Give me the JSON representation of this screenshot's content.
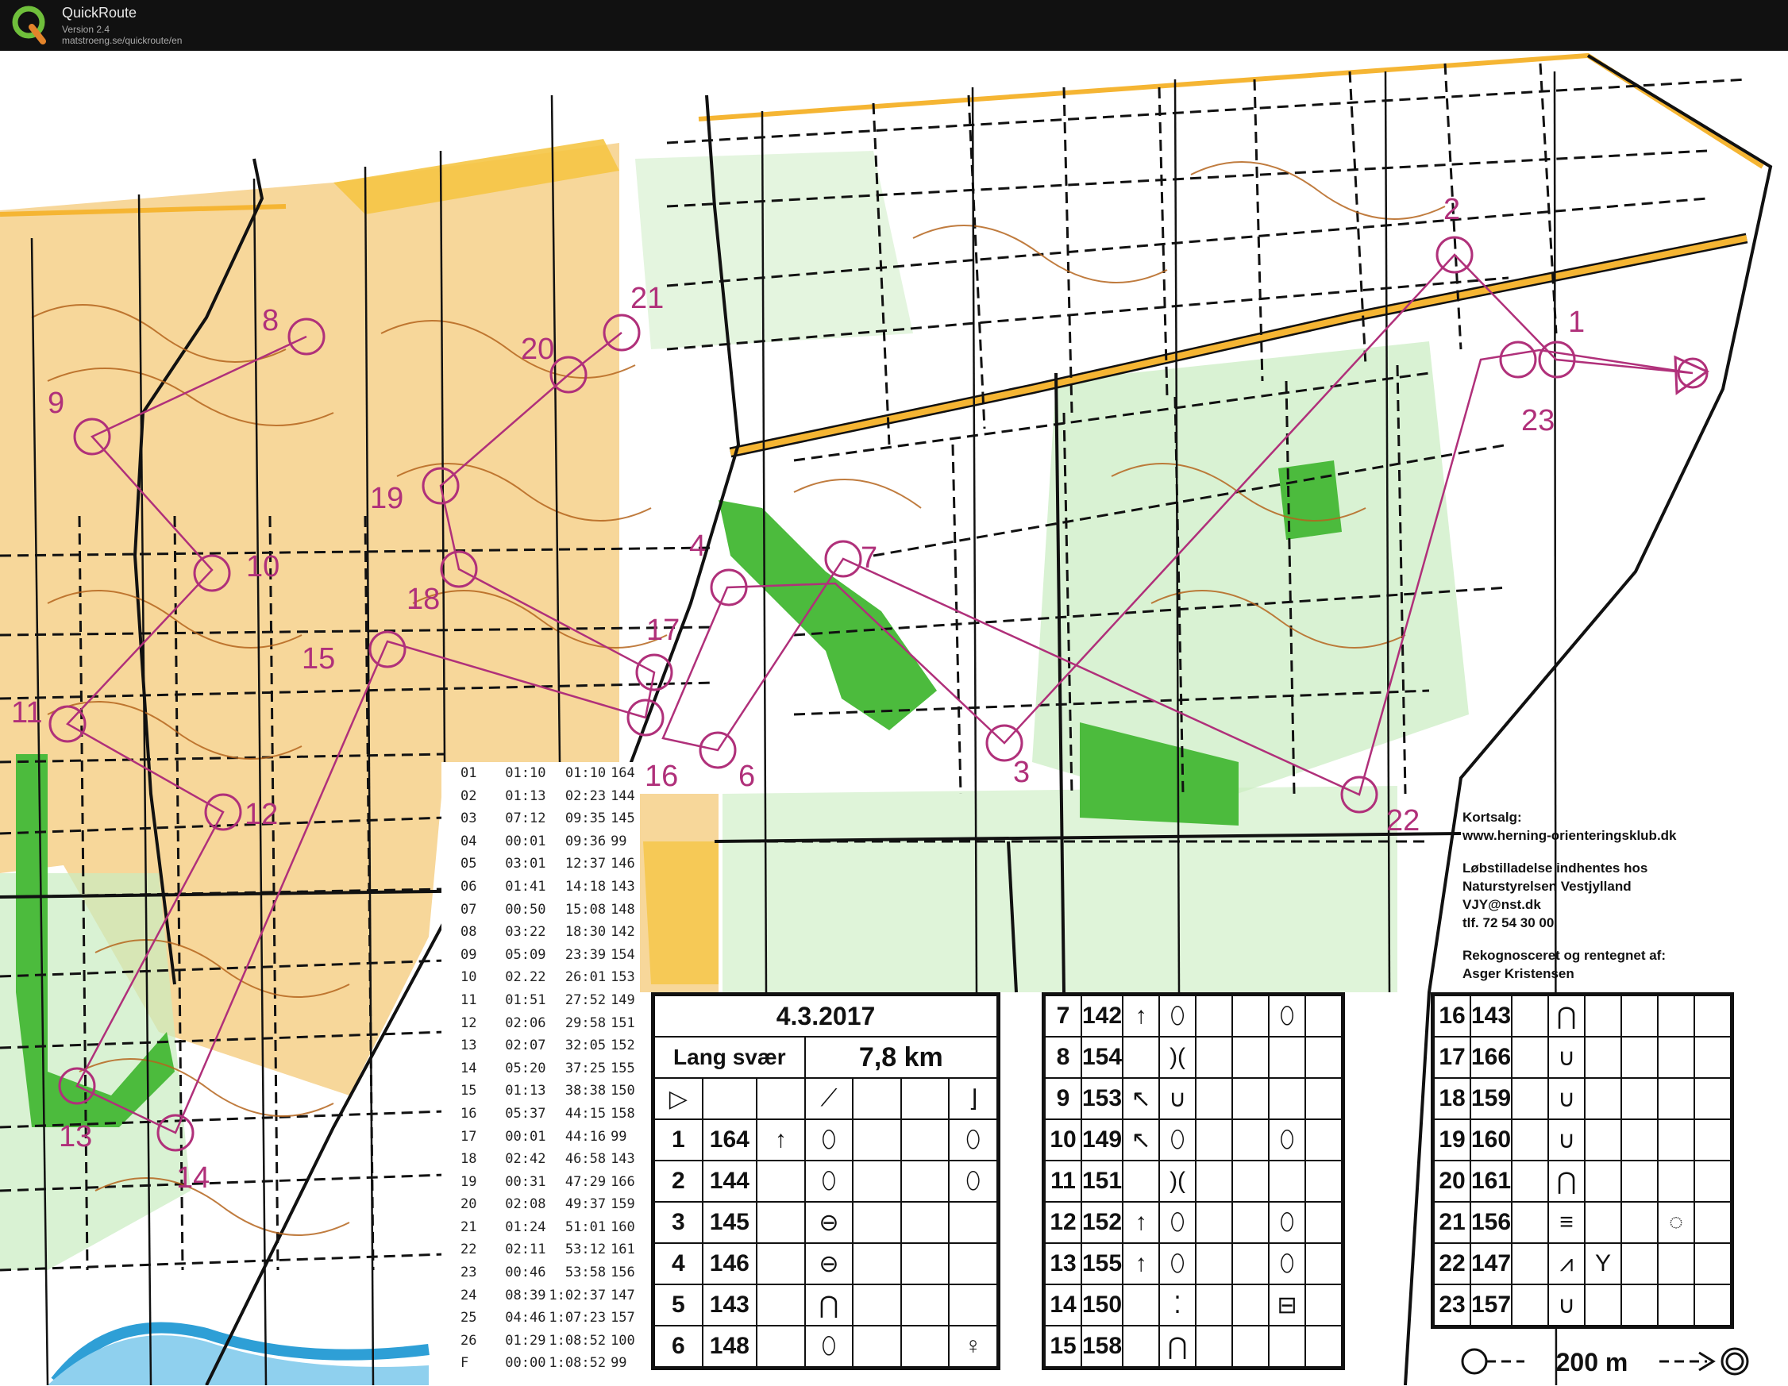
{
  "app": {
    "title": "QuickRoute",
    "version": "Version 2.4",
    "url": "matstroeng.se/quickroute/en",
    "logo_icon": "quickroute-q-logo"
  },
  "colors": {
    "open_land": "#f7d79a",
    "forest": "#ffffff",
    "green": "#4cbb3d",
    "light_green": "#c9ecc0",
    "contour": "#b5651d",
    "course": "#b0307a",
    "road": "#f5b533",
    "track": "#111111",
    "water": "#2e9fd6"
  },
  "controls": [
    {
      "label": "1"
    },
    {
      "label": "2"
    },
    {
      "label": "3"
    },
    {
      "label": "4"
    },
    {
      "label": "6"
    },
    {
      "label": "7"
    },
    {
      "label": "8"
    },
    {
      "label": "9"
    },
    {
      "label": "10"
    },
    {
      "label": "11"
    },
    {
      "label": "12"
    },
    {
      "label": "13"
    },
    {
      "label": "14"
    },
    {
      "label": "15"
    },
    {
      "label": "16"
    },
    {
      "label": "17"
    },
    {
      "label": "18"
    },
    {
      "label": "19"
    },
    {
      "label": "20"
    },
    {
      "label": "21"
    },
    {
      "label": "22"
    },
    {
      "label": "23"
    }
  ],
  "splits": [
    [
      "01",
      "01:10",
      "01:10",
      "164"
    ],
    [
      "02",
      "01:13",
      "02:23",
      "144"
    ],
    [
      "03",
      "07:12",
      "09:35",
      "145"
    ],
    [
      "04",
      "00:01",
      "09:36",
      "99"
    ],
    [
      "05",
      "03:01",
      "12:37",
      "146"
    ],
    [
      "06",
      "01:41",
      "14:18",
      "143"
    ],
    [
      "07",
      "00:50",
      "15:08",
      "148"
    ],
    [
      "08",
      "03:22",
      "18:30",
      "142"
    ],
    [
      "09",
      "05:09",
      "23:39",
      "154"
    ],
    [
      "10",
      "02.22",
      "26:01",
      "153"
    ],
    [
      "11",
      "01:51",
      "27:52",
      "149"
    ],
    [
      "12",
      "02:06",
      "29:58",
      "151"
    ],
    [
      "13",
      "02:07",
      "32:05",
      "152"
    ],
    [
      "14",
      "05:20",
      "37:25",
      "155"
    ],
    [
      "15",
      "01:13",
      "38:38",
      "150"
    ],
    [
      "16",
      "05:37",
      "44:15",
      "158"
    ],
    [
      "17",
      "00:01",
      "44:16",
      "99"
    ],
    [
      "18",
      "02:42",
      "46:58",
      "143"
    ],
    [
      "19",
      "00:31",
      "47:29",
      "166"
    ],
    [
      "20",
      "02:08",
      "49:37",
      "159"
    ],
    [
      "21",
      "01:24",
      "51:01",
      "160"
    ],
    [
      "22",
      "02:11",
      "53:12",
      "161"
    ],
    [
      "23",
      "00:46",
      "53:58",
      "156"
    ],
    [
      "24",
      "08:39",
      "1:02:37",
      "147"
    ],
    [
      "25",
      "04:46",
      "1:07:23",
      "157"
    ],
    [
      "26",
      "01:29",
      "1:08:52",
      "100"
    ],
    [
      "F",
      "00:00",
      "1:08:52",
      "99"
    ]
  ],
  "info": {
    "sale_heading": "Kortsalg:",
    "sale_url": "www.herning-orienteringsklub.dk",
    "permit_line1": "Løbstilladelse indhentes hos",
    "permit_line2": "Naturstyrelsen Vestjylland",
    "permit_email": "VJY@nst.dk",
    "permit_phone": "tlf. 72 54 30 00",
    "survey_heading": "Rekognosceret og rentegnet af:",
    "survey_name": "Asger Kristensen"
  },
  "description": {
    "date": "4.3.2017",
    "class": "Lang svær",
    "length": "7,8 km",
    "start_icon": "start-triangle-icon",
    "rows": [
      {
        "num": "1",
        "code": "164"
      },
      {
        "num": "2",
        "code": "144"
      },
      {
        "num": "3",
        "code": "145"
      },
      {
        "num": "4",
        "code": "146"
      },
      {
        "num": "5",
        "code": "143"
      },
      {
        "num": "6",
        "code": "148"
      },
      {
        "num": "7",
        "code": "142"
      },
      {
        "num": "8",
        "code": "154"
      },
      {
        "num": "9",
        "code": "153"
      },
      {
        "num": "10",
        "code": "149"
      },
      {
        "num": "11",
        "code": "151"
      },
      {
        "num": "12",
        "code": "152"
      },
      {
        "num": "13",
        "code": "155"
      },
      {
        "num": "14",
        "code": "150"
      },
      {
        "num": "15",
        "code": "158"
      },
      {
        "num": "16",
        "code": "143"
      },
      {
        "num": "17",
        "code": "166"
      },
      {
        "num": "18",
        "code": "159"
      },
      {
        "num": "19",
        "code": "160"
      },
      {
        "num": "20",
        "code": "161"
      },
      {
        "num": "21",
        "code": "156"
      },
      {
        "num": "22",
        "code": "147"
      },
      {
        "num": "23",
        "code": "157"
      }
    ],
    "finish_distance": "200 m"
  }
}
